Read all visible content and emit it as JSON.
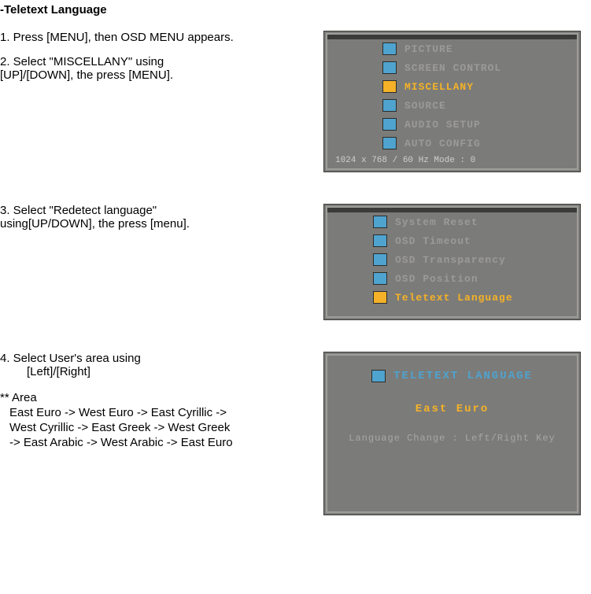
{
  "title": "-Teletext Language",
  "step1": " 1. Press [MENU], then OSD MENU appears.",
  "step2a": " 2. Select \"MISCELLANY\" using",
  "step2b": "[UP]/[DOWN], the press [MENU].",
  "step3a": "3. Select \"Redetect language\"",
  "step3b": "using[UP/DOWN], the press [menu].",
  "step4a": "4. Select User's area using",
  "step4b": "[Left]/[Right]",
  "area_head": " ** Area",
  "area1": "East Euro -> West Euro -> East Cyrillic ->",
  "area2": "West Cyrillic -> East Greek -> West Greek",
  "area3": "-> East Arabic -> West Arabic -> East Euro",
  "menu1": {
    "items": [
      "PICTURE",
      "SCREEN  CONTROL",
      "MISCELLANY",
      "SOURCE",
      "AUDIO  SETUP",
      "AUTO  CONFIG"
    ],
    "selected": 2,
    "footer": "1024  x    768   /    60  Hz        Mode :    0"
  },
  "menu2": {
    "items": [
      "System Reset",
      "OSD Timeout",
      "OSD Transparency",
      "OSD Position",
      "Teletext Language"
    ],
    "selected": 4
  },
  "menu3": {
    "title": "TELETEXT  LANGUAGE",
    "value": "East  Euro",
    "hint": "Language  Change   :   Left/Right Key"
  }
}
